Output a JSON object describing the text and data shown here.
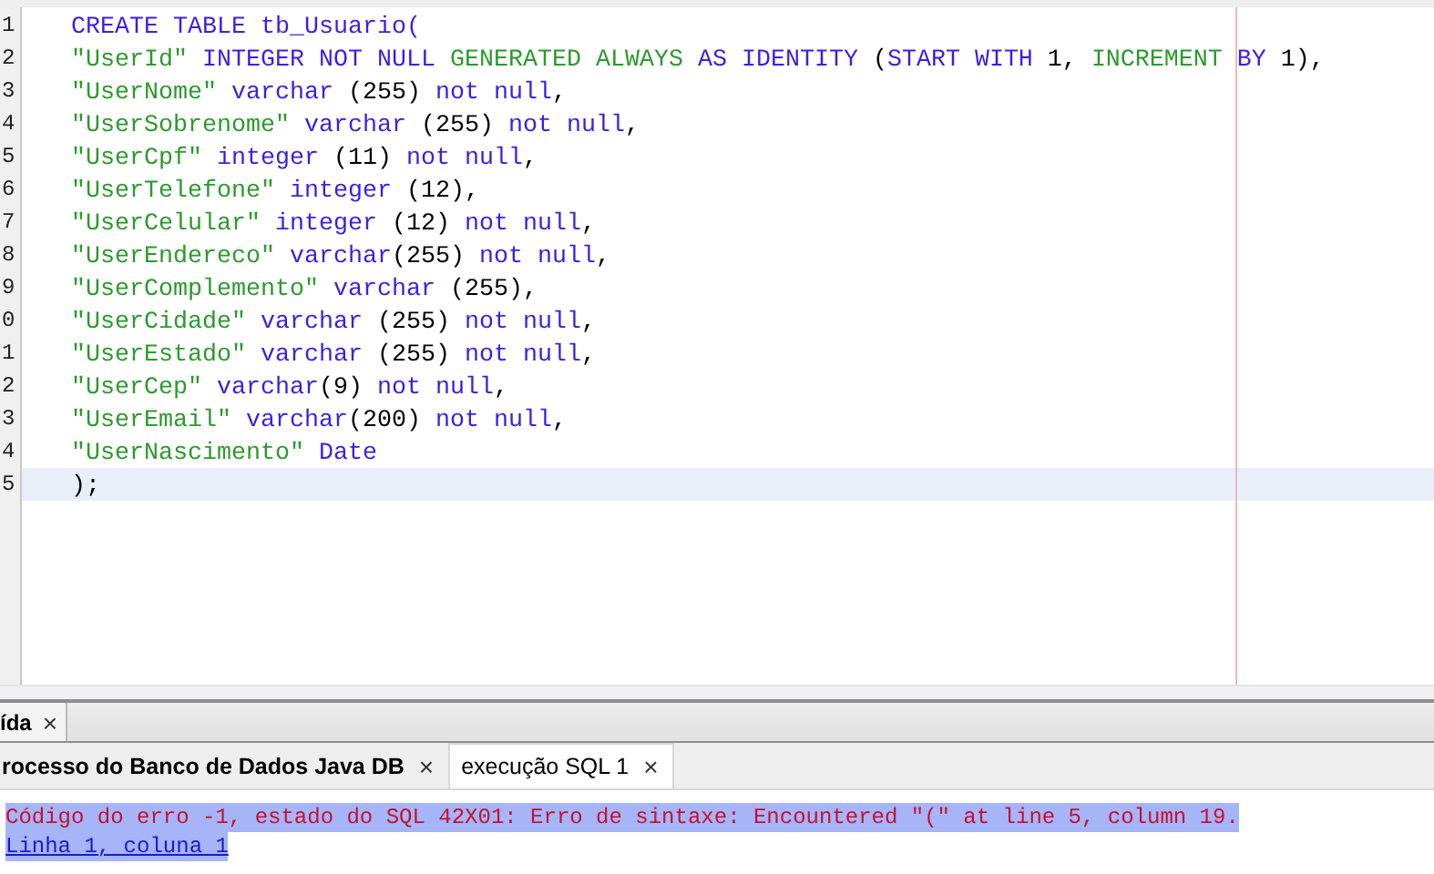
{
  "editor": {
    "lines": [
      {
        "number": "1",
        "current": false,
        "tokens": [
          {
            "kind": "keyword",
            "text": "CREATE TABLE tb_Usuario("
          }
        ]
      },
      {
        "number": "2",
        "current": false,
        "tokens": [
          {
            "kind": "string",
            "text": "\"UserId\""
          },
          {
            "kind": "keyword",
            "text": " INTEGER NOT NULL"
          },
          {
            "kind": "string",
            "text": " GENERATED ALWAYS"
          },
          {
            "kind": "keyword",
            "text": " AS IDENTITY"
          },
          {
            "kind": "plain",
            "text": " ("
          },
          {
            "kind": "keyword",
            "text": "START WITH"
          },
          {
            "kind": "plain",
            "text": " 1, "
          },
          {
            "kind": "string",
            "text": "INCREMENT"
          },
          {
            "kind": "keyword",
            "text": " BY"
          },
          {
            "kind": "plain",
            "text": " 1),"
          }
        ]
      },
      {
        "number": "3",
        "current": false,
        "tokens": [
          {
            "kind": "string",
            "text": "\"UserNome\""
          },
          {
            "kind": "keyword",
            "text": " varchar"
          },
          {
            "kind": "plain",
            "text": " (255) "
          },
          {
            "kind": "keyword",
            "text": "not null"
          },
          {
            "kind": "plain",
            "text": ","
          }
        ]
      },
      {
        "number": "4",
        "current": false,
        "tokens": [
          {
            "kind": "string",
            "text": "\"UserSobrenome\""
          },
          {
            "kind": "keyword",
            "text": " varchar"
          },
          {
            "kind": "plain",
            "text": " (255) "
          },
          {
            "kind": "keyword",
            "text": "not null"
          },
          {
            "kind": "plain",
            "text": ","
          }
        ]
      },
      {
        "number": "5",
        "current": false,
        "tokens": [
          {
            "kind": "string",
            "text": "\"UserCpf\""
          },
          {
            "kind": "keyword",
            "text": " integer"
          },
          {
            "kind": "plain",
            "text": " (11) "
          },
          {
            "kind": "keyword",
            "text": "not null"
          },
          {
            "kind": "plain",
            "text": ","
          }
        ]
      },
      {
        "number": "6",
        "current": false,
        "tokens": [
          {
            "kind": "string",
            "text": "\"UserTelefone\""
          },
          {
            "kind": "keyword",
            "text": " integer"
          },
          {
            "kind": "plain",
            "text": " (12),"
          }
        ]
      },
      {
        "number": "7",
        "current": false,
        "tokens": [
          {
            "kind": "string",
            "text": "\"UserCelular\""
          },
          {
            "kind": "keyword",
            "text": " integer"
          },
          {
            "kind": "plain",
            "text": " (12) "
          },
          {
            "kind": "keyword",
            "text": "not null"
          },
          {
            "kind": "plain",
            "text": ","
          }
        ]
      },
      {
        "number": "8",
        "current": false,
        "tokens": [
          {
            "kind": "string",
            "text": "\"UserEndereco\""
          },
          {
            "kind": "keyword",
            "text": " varchar"
          },
          {
            "kind": "plain",
            "text": "(255) "
          },
          {
            "kind": "keyword",
            "text": "not null"
          },
          {
            "kind": "plain",
            "text": ","
          }
        ]
      },
      {
        "number": "9",
        "current": false,
        "tokens": [
          {
            "kind": "string",
            "text": "\"UserComplemento\""
          },
          {
            "kind": "keyword",
            "text": " varchar"
          },
          {
            "kind": "plain",
            "text": " (255),"
          }
        ]
      },
      {
        "number": "0",
        "current": false,
        "tokens": [
          {
            "kind": "string",
            "text": "\"UserCidade\""
          },
          {
            "kind": "keyword",
            "text": " varchar"
          },
          {
            "kind": "plain",
            "text": " (255) "
          },
          {
            "kind": "keyword",
            "text": "not null"
          },
          {
            "kind": "plain",
            "text": ","
          }
        ]
      },
      {
        "number": "1",
        "current": false,
        "tokens": [
          {
            "kind": "string",
            "text": "\"UserEstado\""
          },
          {
            "kind": "keyword",
            "text": " varchar"
          },
          {
            "kind": "plain",
            "text": " (255) "
          },
          {
            "kind": "keyword",
            "text": "not null"
          },
          {
            "kind": "plain",
            "text": ","
          }
        ]
      },
      {
        "number": "2",
        "current": false,
        "tokens": [
          {
            "kind": "string",
            "text": "\"UserCep\""
          },
          {
            "kind": "keyword",
            "text": " varchar"
          },
          {
            "kind": "plain",
            "text": "(9) "
          },
          {
            "kind": "keyword",
            "text": "not null"
          },
          {
            "kind": "plain",
            "text": ","
          }
        ]
      },
      {
        "number": "3",
        "current": false,
        "tokens": [
          {
            "kind": "string",
            "text": "\"UserEmail\""
          },
          {
            "kind": "keyword",
            "text": " varchar"
          },
          {
            "kind": "plain",
            "text": "(200) "
          },
          {
            "kind": "keyword",
            "text": "not null"
          },
          {
            "kind": "plain",
            "text": ","
          }
        ]
      },
      {
        "number": "4",
        "current": false,
        "tokens": [
          {
            "kind": "string",
            "text": "\"UserNascimento\""
          },
          {
            "kind": "keyword",
            "text": " Date"
          }
        ]
      },
      {
        "number": "5",
        "current": true,
        "tokens": [
          {
            "kind": "plain",
            "text": ");"
          }
        ]
      }
    ]
  },
  "upper_tabs": [
    {
      "label": "ída",
      "close": "×",
      "selected": true
    }
  ],
  "output_tabs": [
    {
      "label": "rocesso do Banco de Dados Java DB",
      "close": "×",
      "selected": false
    },
    {
      "label": "execução SQL 1",
      "close": "×",
      "selected": true
    }
  ],
  "output": [
    {
      "kind": "error",
      "text": "Código do erro -1, estado do SQL 42X01: Erro de sintaxe: Encountered \"(\" at line 5, column 19.",
      "highlighted": true
    },
    {
      "kind": "link",
      "text": "Linha 1, coluna 1",
      "highlighted": true
    }
  ]
}
